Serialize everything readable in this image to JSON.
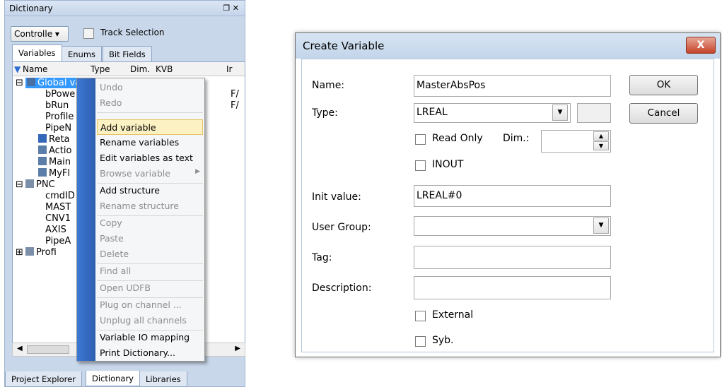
{
  "dictionary": {
    "title": "Dictionary",
    "pin_icon": "⬚ ✕",
    "controller_combo": "Controlle ▾",
    "track_selection": "Track Selection",
    "tabs": [
      "Variables",
      "Enums",
      "Bit Fields"
    ],
    "columns": [
      "Name",
      "Type",
      "Dim.",
      "KVB",
      "Ir"
    ],
    "rows": {
      "global": "Global variables",
      "bPower": "bPowe",
      "bRun": "bRun",
      "profile": "Profile",
      "pipeN": "PipeN",
      "retain": "Reta",
      "action": "Actio",
      "main": "Main",
      "myF": "MyFl",
      "pnc": "PNC",
      "cmdID": "cmdID",
      "mast": "MAST",
      "cnv1": "CNV1",
      "axis": "AXIS",
      "pipeA": "PipeA",
      "profi": "Profi"
    },
    "type_fragments": [
      "F/",
      "F/"
    ],
    "bottom_tabs": [
      "Project Explorer",
      "Dictionary",
      "Libraries"
    ]
  },
  "context_menu": {
    "items": [
      {
        "label": "Undo",
        "enabled": false
      },
      {
        "label": "Redo",
        "enabled": false
      },
      {
        "label": "Add variable",
        "enabled": true,
        "highlighted": true
      },
      {
        "label": "Rename variables",
        "enabled": true
      },
      {
        "label": "Edit variables as text",
        "enabled": true
      },
      {
        "label": "Browse variable",
        "enabled": false
      },
      {
        "label": "Add structure",
        "enabled": true
      },
      {
        "label": "Rename structure",
        "enabled": false
      },
      {
        "label": "Copy",
        "enabled": false
      },
      {
        "label": "Paste",
        "enabled": false
      },
      {
        "label": "Delete",
        "enabled": false
      },
      {
        "label": "Find all",
        "enabled": false
      },
      {
        "label": "Open UDFB",
        "enabled": false
      },
      {
        "label": "Plug on channel ...",
        "enabled": false
      },
      {
        "label": "Unplug all channels",
        "enabled": false
      },
      {
        "label": "Variable IO mapping",
        "enabled": true
      },
      {
        "label": "Print Dictionary...",
        "enabled": true
      }
    ]
  },
  "dialog": {
    "title": "Create Variable",
    "close": "X",
    "labels": {
      "name": "Name:",
      "type": "Type:",
      "read_only": "Read Only",
      "dim": "Dim.:",
      "inout": "INOUT",
      "init_value": "Init value:",
      "user_group": "User Group:",
      "tag": "Tag:",
      "description": "Description:",
      "external": "External",
      "syb": "Syb."
    },
    "values": {
      "name": "MasterAbsPos",
      "type": "LREAL",
      "init_value": "LREAL#0",
      "user_group": "",
      "tag": "",
      "description": "",
      "dim": ""
    },
    "buttons": {
      "ok": "OK",
      "cancel": "Cancel"
    }
  }
}
